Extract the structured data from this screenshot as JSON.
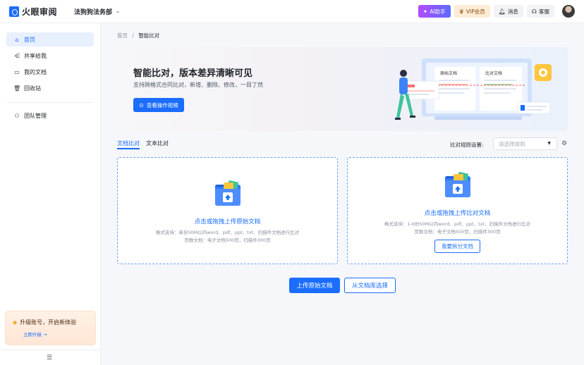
{
  "header": {
    "logo_text": "火眼审阅",
    "workspace": "法狗狗法务部",
    "ai_label": "AI助手",
    "vip_label": "VIP会员",
    "messages_label": "消息",
    "service_label": "客服"
  },
  "sidebar": {
    "items": [
      {
        "label": "首页",
        "icon": "home-icon",
        "active": true
      },
      {
        "label": "共享给我",
        "icon": "share-icon"
      },
      {
        "label": "我的文档",
        "icon": "folder-icon"
      },
      {
        "label": "回收站",
        "icon": "trash-icon"
      },
      {
        "label": "团队管理",
        "icon": "team-icon"
      }
    ],
    "upgrade": {
      "title": "升级账号，开启新体验",
      "link": "立即升级 →"
    }
  },
  "breadcrumb": {
    "home": "首页",
    "separator": "/",
    "current": "智能比对"
  },
  "banner": {
    "title": "智能比对，版本差异清晰可见",
    "subtitle": "支持跨格式合同比对，新增、删除、修改，一目了然",
    "button": "查看操作视频",
    "illus_left_doc": "原始文档",
    "illus_right_doc": "比对文档"
  },
  "tabs": {
    "doc_compare": "文档比对",
    "text_compare": "文本比对"
  },
  "rules": {
    "label": "比对规则设置:",
    "placeholder": "请选择规则"
  },
  "upload_original": {
    "title": "点击或拖拽上传原始文档",
    "hint_line1": "格式支持：单份50M以内word、pdf、ppt、txt、扫描件文档进行比对",
    "hint_line2": "页数文档：电子文档500页，扫描件300页"
  },
  "upload_compare": {
    "title": "点击或拖拽上传比对文档",
    "hint_line1": "格式支持：1-6份50M以内word、pdf、ppt、txt、扫描件文档进行比对",
    "hint_line2": "页数文档：电子文档500页，扫描件300页",
    "split_button": "我要拆分文档"
  },
  "actions": {
    "upload_original": "上传原始文档",
    "choose_from_library": "从文档库选择"
  },
  "colors": {
    "primary": "#1a6dff",
    "active_nav_bg": "#e8f0ff"
  }
}
